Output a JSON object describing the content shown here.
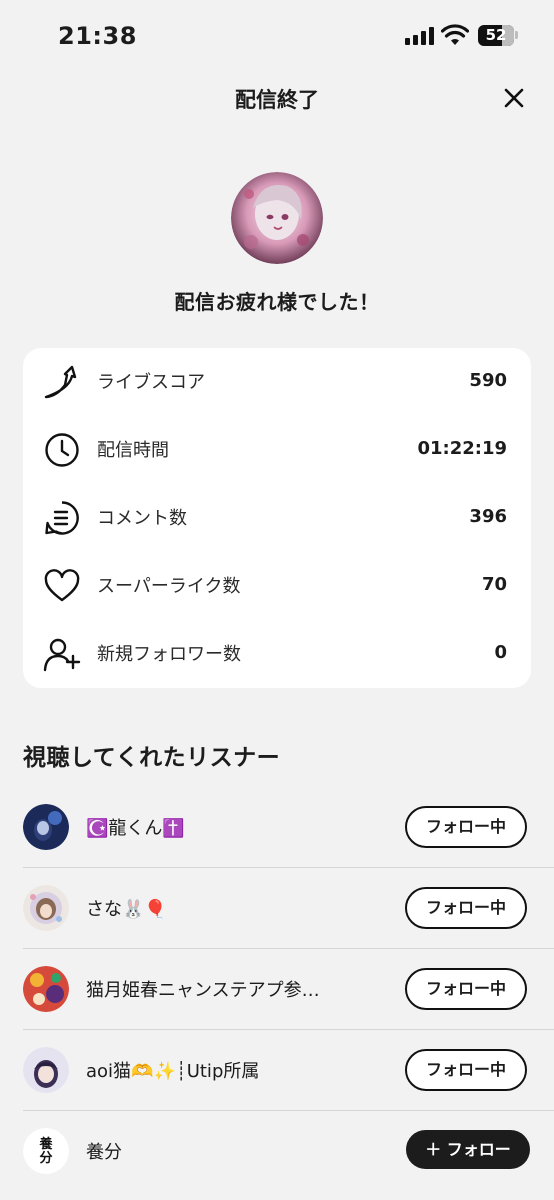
{
  "status_bar": {
    "time": "21:38",
    "battery": "52"
  },
  "header": {
    "title": "配信終了",
    "close_icon": "close-icon"
  },
  "thanks_message": "配信お疲れ様でした！",
  "stats": [
    {
      "icon": "live-score-icon",
      "label": "ライブスコア",
      "value": "590"
    },
    {
      "icon": "clock-icon",
      "label": "配信時間",
      "value": "01:22:19"
    },
    {
      "icon": "comment-icon",
      "label": "コメント数",
      "value": "396"
    },
    {
      "icon": "heart-icon",
      "label": "スーパーライク数",
      "value": "70"
    },
    {
      "icon": "add-user-icon",
      "label": "新規フォロワー数",
      "value": "0"
    }
  ],
  "listeners_title": "視聴してくれたリスナー",
  "listeners": [
    {
      "name": "☪️龍くん✝️",
      "button": "フォロー中",
      "following": true
    },
    {
      "name": "さな🐰🎈",
      "button": "フォロー中",
      "following": true
    },
    {
      "name": "猫月姫春ニャンステアプ参…",
      "button": "フォロー中",
      "following": true
    },
    {
      "name": "aoi猫🫶✨┊Utip所属",
      "button": "フォロー中",
      "following": true
    },
    {
      "name": "養分",
      "avatar_text": "養分",
      "button": "＋ フォロー",
      "following": false
    }
  ],
  "colors": {
    "background": "#f2f2f2",
    "card": "#ffffff",
    "text": "#1c1c1c",
    "button_dark": "#1c1c1c"
  }
}
